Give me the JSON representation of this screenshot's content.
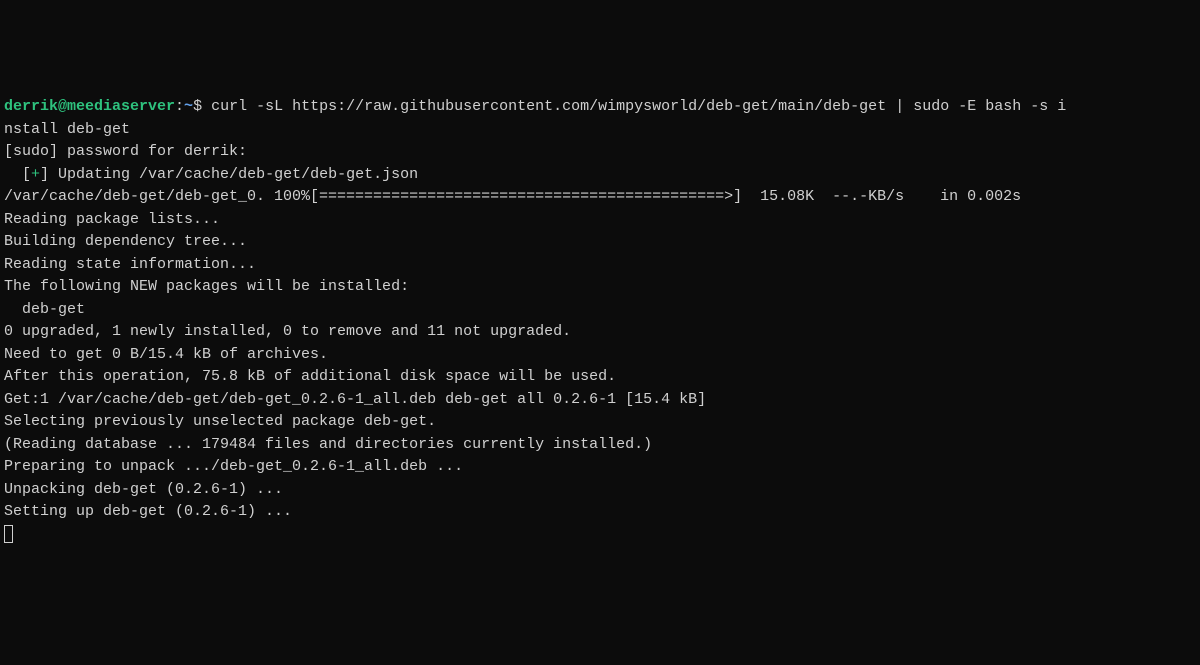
{
  "prompt": {
    "user_host": "derrik@meediaserver",
    "colon": ":",
    "tilde": "~",
    "dollar": "$"
  },
  "command": " curl -sL https://raw.githubusercontent.com/wimpysworld/deb-get/main/deb-get | sudo -E bash -s i",
  "lines": {
    "l01": "nstall deb-get",
    "l02": "[sudo] password for derrik:",
    "l03a": "  [",
    "l03plus": "+",
    "l03b": "] Updating /var/cache/deb-get/deb-get.json",
    "l04": "/var/cache/deb-get/deb-get_0. 100%[=============================================>]  15.08K  --.-KB/s    in 0.002s",
    "l05": "Reading package lists...",
    "l06": "Building dependency tree...",
    "l07": "Reading state information...",
    "l08": "The following NEW packages will be installed:",
    "l09": "  deb-get",
    "l10": "0 upgraded, 1 newly installed, 0 to remove and 11 not upgraded.",
    "l11": "Need to get 0 B/15.4 kB of archives.",
    "l12": "After this operation, 75.8 kB of additional disk space will be used.",
    "l13": "Get:1 /var/cache/deb-get/deb-get_0.2.6-1_all.deb deb-get all 0.2.6-1 [15.4 kB]",
    "l14": "Selecting previously unselected package deb-get.",
    "l15": "(Reading database ... 179484 files and directories currently installed.)",
    "l16": "Preparing to unpack .../deb-get_0.2.6-1_all.deb ...",
    "l17": "Unpacking deb-get (0.2.6-1) ...",
    "l18": "Setting up deb-get (0.2.6-1) ..."
  }
}
